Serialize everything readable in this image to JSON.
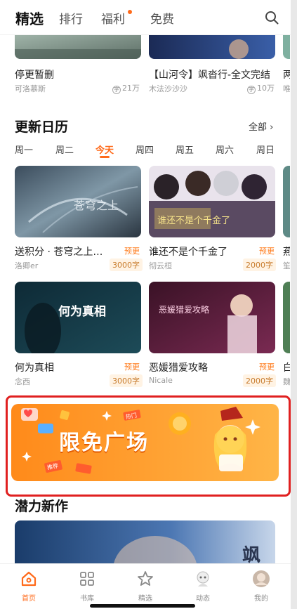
{
  "top_tabs": [
    "精选",
    "排行",
    "福利",
    "免费"
  ],
  "top_row_books": [
    {
      "title": "停更暂删",
      "author": "可洛慕斯",
      "meta": "21万"
    },
    {
      "title": "【山河令】飒沓行-全文完结",
      "author": "木法沙沙沙",
      "meta": "10万"
    },
    {
      "title": "两",
      "author": "唯"
    }
  ],
  "update_calendar": {
    "title": "更新日历",
    "all_label": "全部",
    "days": [
      "周一",
      "周二",
      "今天",
      "周四",
      "周五",
      "周六",
      "周日"
    ],
    "books": [
      {
        "title": "送积分 · 苍穹之上…",
        "badge": "预更",
        "author": "洛卿er",
        "count": "3000字",
        "cover_text": "苍穹之上"
      },
      {
        "title": "谁还不是个千金了",
        "badge": "预更",
        "author": "彻云桓",
        "count": "2000字",
        "cover_text": "谁还不是个千金了"
      },
      {
        "title": "何为真相",
        "badge": "预更",
        "author": "念西",
        "count": "3000字",
        "cover_text": "何为真相"
      },
      {
        "title": "恶媛猎爱攻略",
        "badge": "预更",
        "author": "Nicale",
        "count": "2000字",
        "cover_text": "恶媛猎爱攻略"
      }
    ],
    "partial_right": [
      "燕",
      "笙",
      "白",
      "魏"
    ]
  },
  "promo": {
    "text": "限免广场",
    "sticker_hot": "热门",
    "sticker_recommend": "推荐"
  },
  "new_works": {
    "title": "潜力新作",
    "cover_text": "飒"
  },
  "bottom_nav": [
    "首页",
    "书库",
    "精选",
    "动态",
    "我的"
  ],
  "colors": {
    "accent": "#ff6a1a",
    "highlight_frame": "#e02020"
  }
}
